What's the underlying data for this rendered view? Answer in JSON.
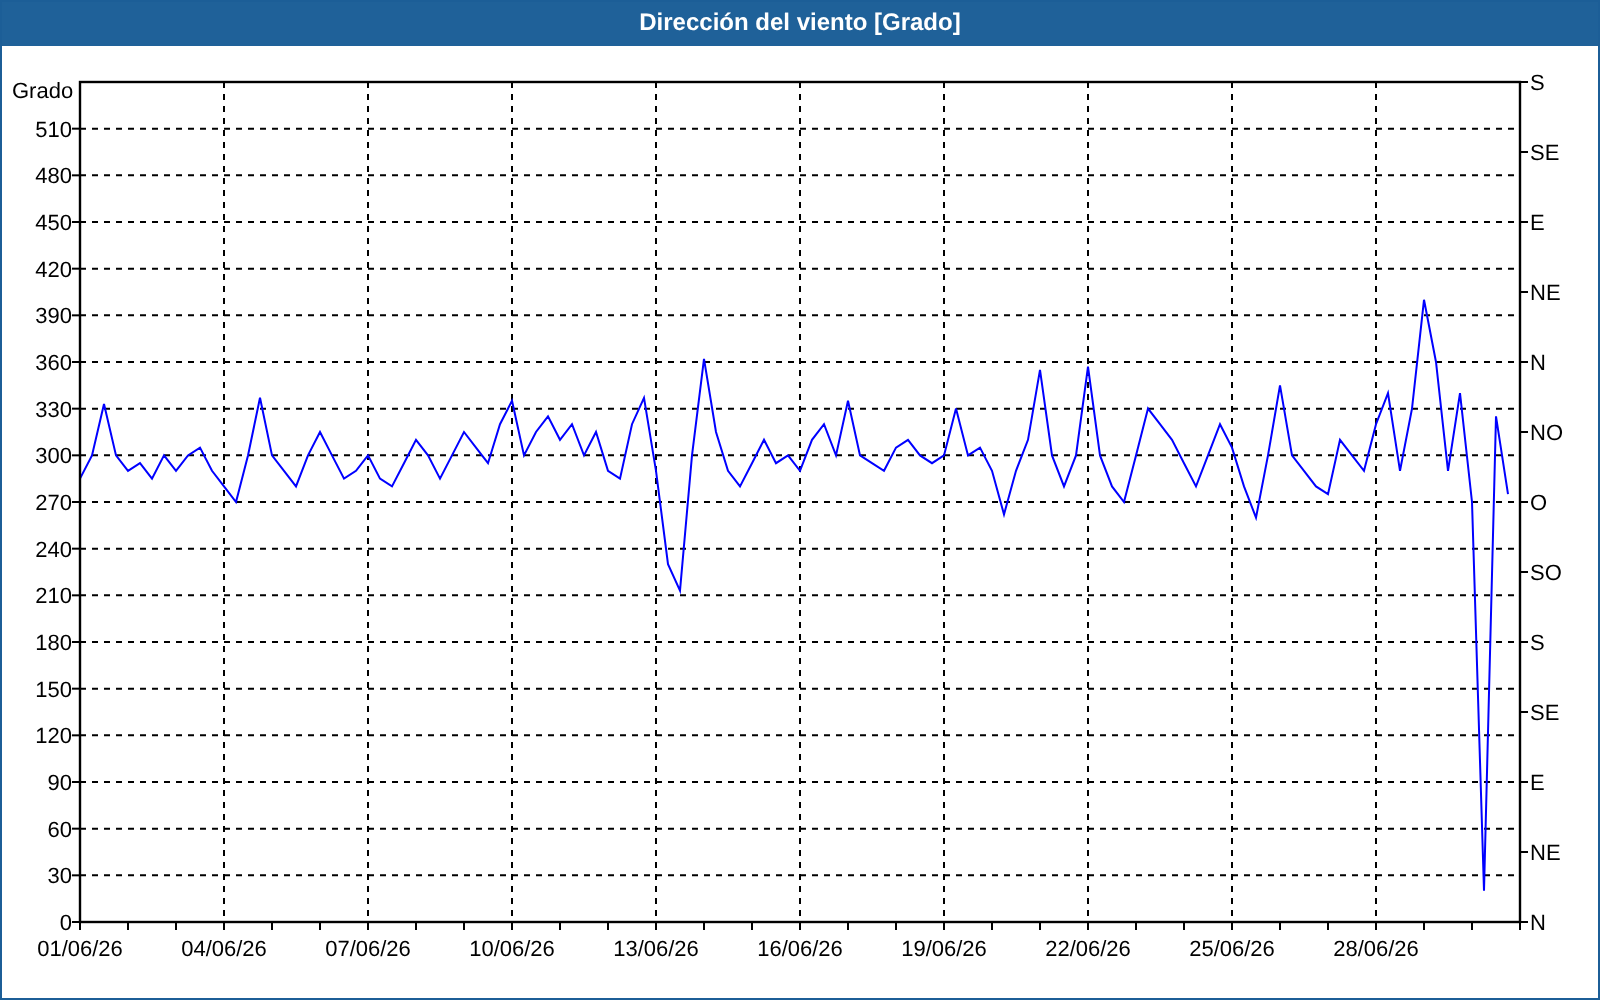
{
  "window": {
    "title": "Dirección del viento [Grado]"
  },
  "chart": {
    "chart_data": {
      "type": "line",
      "grid": true,
      "ylabel": "Grado",
      "ylim": [
        0,
        540
      ],
      "categories": [
        "01/06/26",
        null,
        null,
        null,
        null,
        null,
        null,
        null,
        null,
        null,
        null,
        null,
        "04/06/26",
        null,
        null,
        null,
        null,
        null,
        null,
        null,
        null,
        null,
        null,
        null,
        "07/06/26",
        null,
        null,
        null,
        null,
        null,
        null,
        null,
        null,
        null,
        null,
        null,
        "10/06/26",
        null,
        null,
        null,
        null,
        null,
        null,
        null,
        null,
        null,
        null,
        null,
        "13/06/26",
        null,
        null,
        null,
        null,
        null,
        null,
        null,
        null,
        null,
        null,
        null,
        "16/06/26",
        null,
        null,
        null,
        null,
        null,
        null,
        null,
        null,
        null,
        null,
        null,
        "19/06/26",
        null,
        null,
        null,
        null,
        null,
        null,
        null,
        null,
        null,
        null,
        null,
        "22/06/26",
        null,
        null,
        null,
        null,
        null,
        null,
        null,
        null,
        null,
        null,
        null,
        "25/06/26",
        null,
        null,
        null,
        null,
        null,
        null,
        null,
        null,
        null,
        null,
        null,
        "28/06/26",
        null,
        null,
        null,
        null,
        null,
        null,
        null,
        null,
        null,
        null,
        null
      ],
      "yticks": [
        0,
        30,
        60,
        90,
        120,
        150,
        180,
        210,
        240,
        270,
        300,
        330,
        360,
        390,
        420,
        450,
        480,
        510
      ],
      "series": [
        {
          "color": "#0000ff",
          "values": [
            285,
            300,
            333,
            300,
            290,
            295,
            285,
            300,
            290,
            300,
            305,
            290,
            280,
            270,
            300,
            337,
            300,
            290,
            280,
            300,
            315,
            300,
            285,
            290,
            300,
            285,
            280,
            295,
            310,
            300,
            285,
            300,
            315,
            305,
            295,
            320,
            335,
            300,
            315,
            325,
            310,
            320,
            300,
            315,
            290,
            285,
            320,
            337,
            290,
            230,
            213,
            300,
            362,
            315,
            290,
            280,
            295,
            310,
            295,
            300,
            290,
            310,
            320,
            300,
            335,
            300,
            295,
            290,
            305,
            310,
            300,
            295,
            300,
            330,
            300,
            305,
            290,
            262,
            290,
            310,
            355,
            300,
            280,
            300,
            357,
            300,
            280,
            270,
            300,
            330,
            320,
            310,
            295,
            280,
            300,
            320,
            305,
            280,
            260,
            300,
            345,
            300,
            290,
            280,
            275,
            310,
            300,
            290,
            320,
            340,
            290,
            330,
            400,
            360,
            290,
            340,
            270,
            20,
            325,
            275
          ]
        }
      ]
    },
    "compass_labels": [
      "S",
      "SE",
      "E",
      "NE",
      "N",
      "NO",
      "O",
      "SO",
      "S",
      "SE",
      "E",
      "NE",
      "N"
    ]
  }
}
